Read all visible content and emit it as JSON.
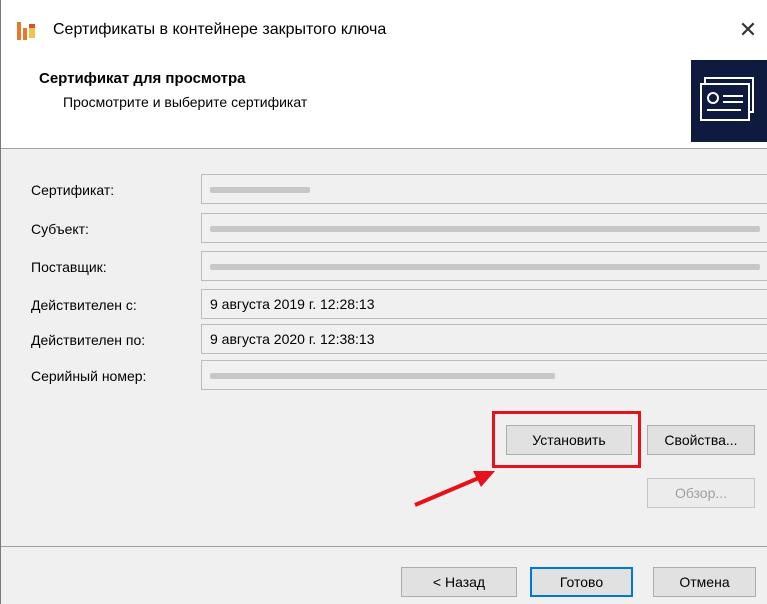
{
  "window": {
    "title": "Сертификаты в контейнере закрытого ключа",
    "close_symbol": "✕"
  },
  "header": {
    "title": "Сертификат для просмотра",
    "subtitle": "Просмотрите и выберите сертификат"
  },
  "fields": [
    {
      "label": "Сертификат:",
      "value": ""
    },
    {
      "label": "Субъект:",
      "value": ""
    },
    {
      "label": "Поставщик:",
      "value": ""
    },
    {
      "label": "Действителен с:",
      "value": "9 августа 2019 г. 12:28:13"
    },
    {
      "label": "Действителен по:",
      "value": "9 августа 2020 г. 12:38:13"
    },
    {
      "label": "Серийный номер:",
      "value": ""
    }
  ],
  "buttons": {
    "install": "Установить",
    "properties": "Свойства...",
    "browse": "Обзор...",
    "back": "< Назад",
    "finish": "Готово",
    "cancel": "Отмена"
  },
  "colors": {
    "highlight": "#e5121b",
    "header_image": "#0f1a3f",
    "default_button_border": "#0078d7"
  }
}
